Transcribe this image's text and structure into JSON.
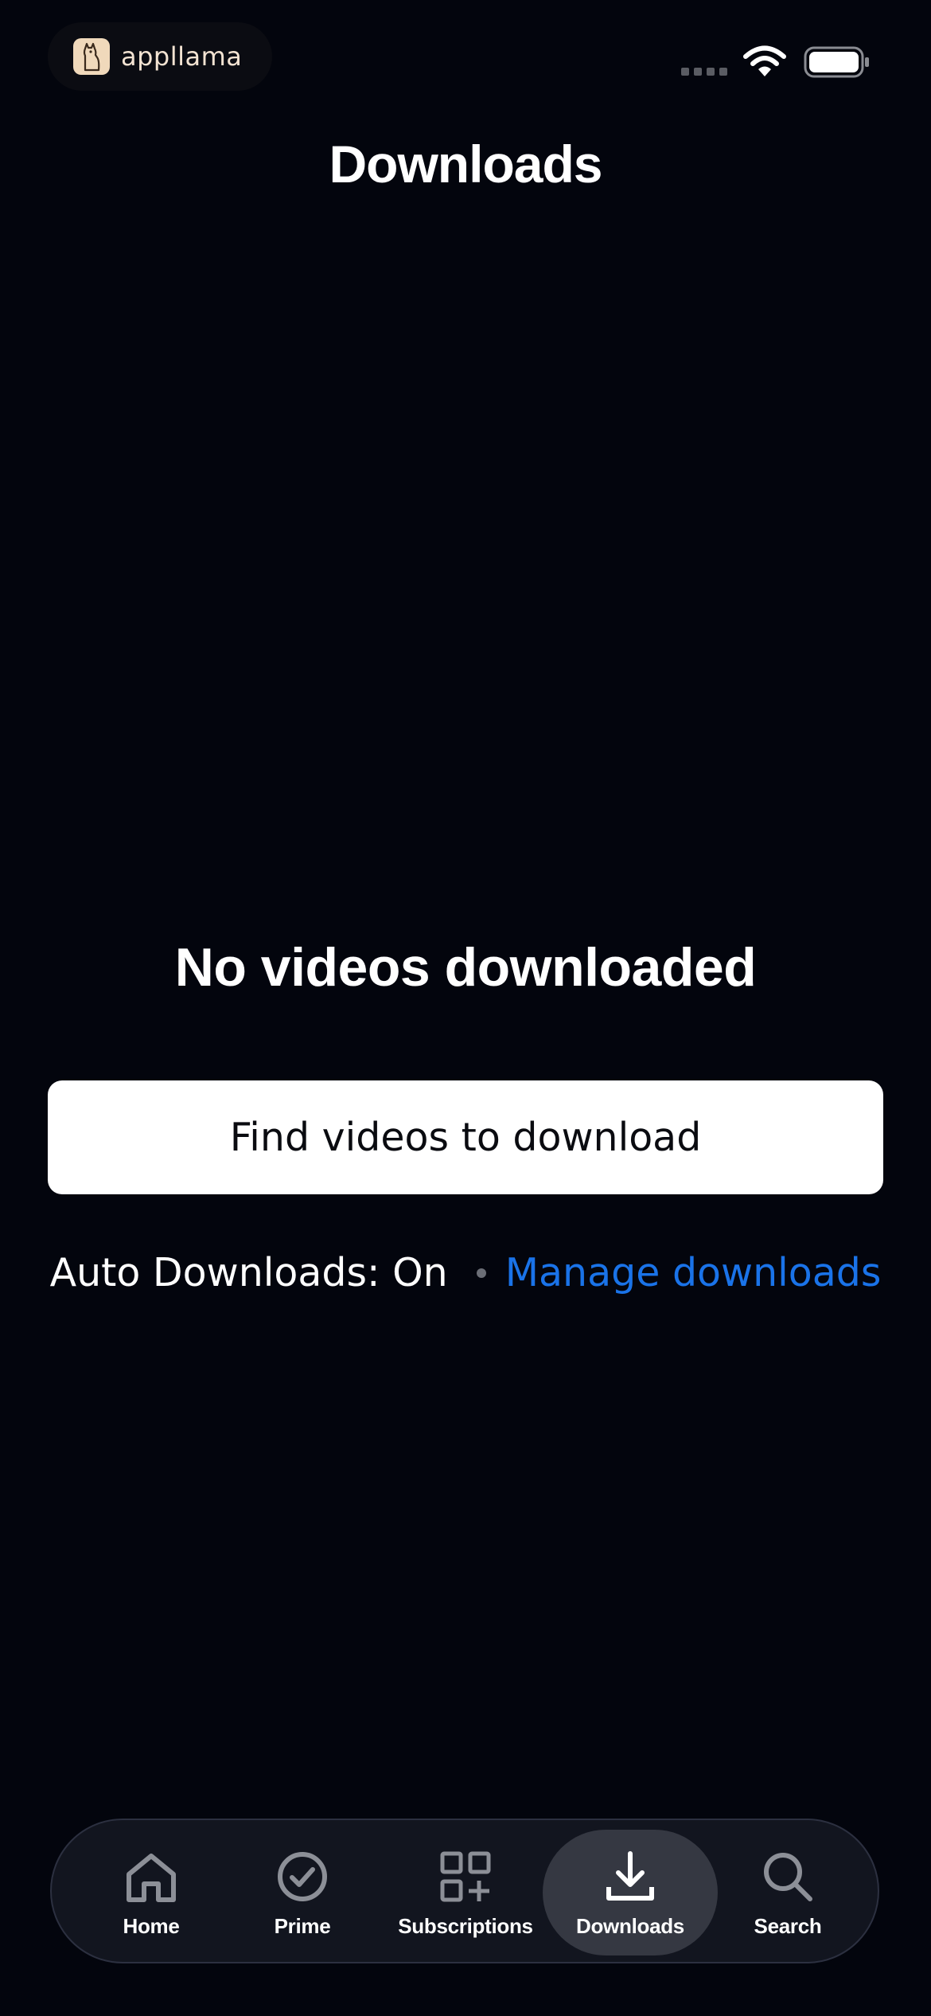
{
  "status_bar": {
    "brand_name": "appllama"
  },
  "header": {
    "title": "Downloads"
  },
  "empty_state": {
    "title": "No videos downloaded",
    "find_button_label": "Find videos to download",
    "auto_downloads_status": "Auto Downloads: On",
    "manage_link_label": "Manage downloads"
  },
  "tab_bar": {
    "active": "Downloads",
    "tabs": [
      {
        "label": "Home",
        "icon": "home-icon"
      },
      {
        "label": "Prime",
        "icon": "check-circle-icon"
      },
      {
        "label": "Subscriptions",
        "icon": "grid-plus-icon"
      },
      {
        "label": "Downloads",
        "icon": "download-icon"
      },
      {
        "label": "Search",
        "icon": "search-icon"
      }
    ]
  },
  "colors": {
    "background": "#03050d",
    "link": "#1a73e8",
    "tab_bar": "#12151f",
    "active_tab": "#353842"
  }
}
